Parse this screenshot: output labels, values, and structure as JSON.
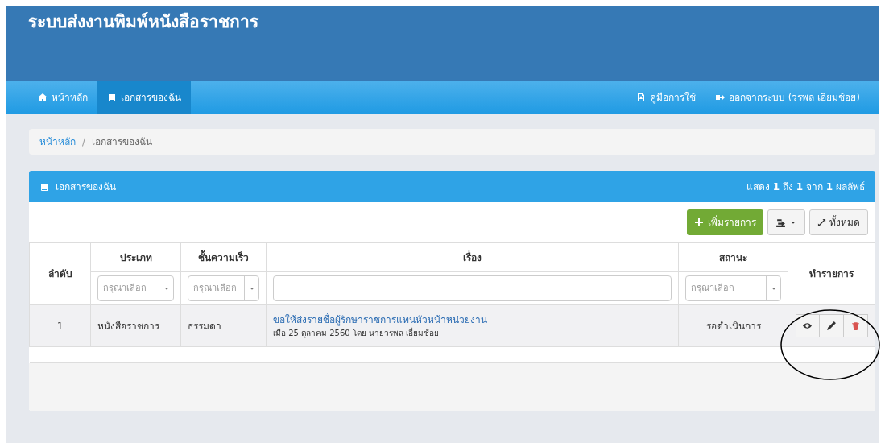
{
  "header": {
    "title": "ระบบส่งงานพิมพ์หนังสือราชการ"
  },
  "nav": {
    "items": [
      {
        "label": "หน้าหลัก",
        "selected": false
      },
      {
        "label": "เอกสารของฉัน",
        "selected": true
      }
    ],
    "right_items": [
      {
        "label": "คู่มือการใช้"
      },
      {
        "label": "ออกจากระบบ (วรพล เอี่ยมช้อย)"
      }
    ]
  },
  "breadcrumb": {
    "separator": "/",
    "items": [
      {
        "label": "หน้าหลัก",
        "selected": false
      },
      {
        "label": "เอกสารของฉัน",
        "selected": true
      }
    ]
  },
  "panel": {
    "title": "เอกสารของฉัน",
    "summary": "แสดง **1** ถึง **1** จาก **1** ผลลัพธ์",
    "toolbar": {
      "add_button": "เพิ่มรายการ",
      "expand_button": "ทั้งหมด"
    },
    "table": {
      "columns": [
        "ลำดับ",
        "ประเภท",
        "ชั้นความเร็ว",
        "เรื่อง",
        "สถานะ",
        "ทำรายการ"
      ],
      "filters": [
        {
          "kind": "none"
        },
        {
          "kind": "select",
          "placeholder": "กรุณาเลือก"
        },
        {
          "kind": "select",
          "placeholder": "กรุณาเลือก"
        },
        {
          "kind": "text"
        },
        {
          "kind": "select",
          "placeholder": "กรุณาเลือก"
        },
        {
          "kind": "none"
        }
      ],
      "rows": [
        {
          "index": "1",
          "type": "หนังสือราชการ",
          "speed": "ธรรมดา",
          "subject": "ขอให้ส่งรายชื่อผู้รักษาราชการแทนหัวหน้าหน่วยงาน",
          "meta": "เมื่อ 25 ตุลาคม 2560 โดย นายวรพล เอี่ยมช้อย",
          "status": "รอดำเนินการ"
        }
      ]
    }
  },
  "annotation": {
    "kind": "circle"
  }
}
